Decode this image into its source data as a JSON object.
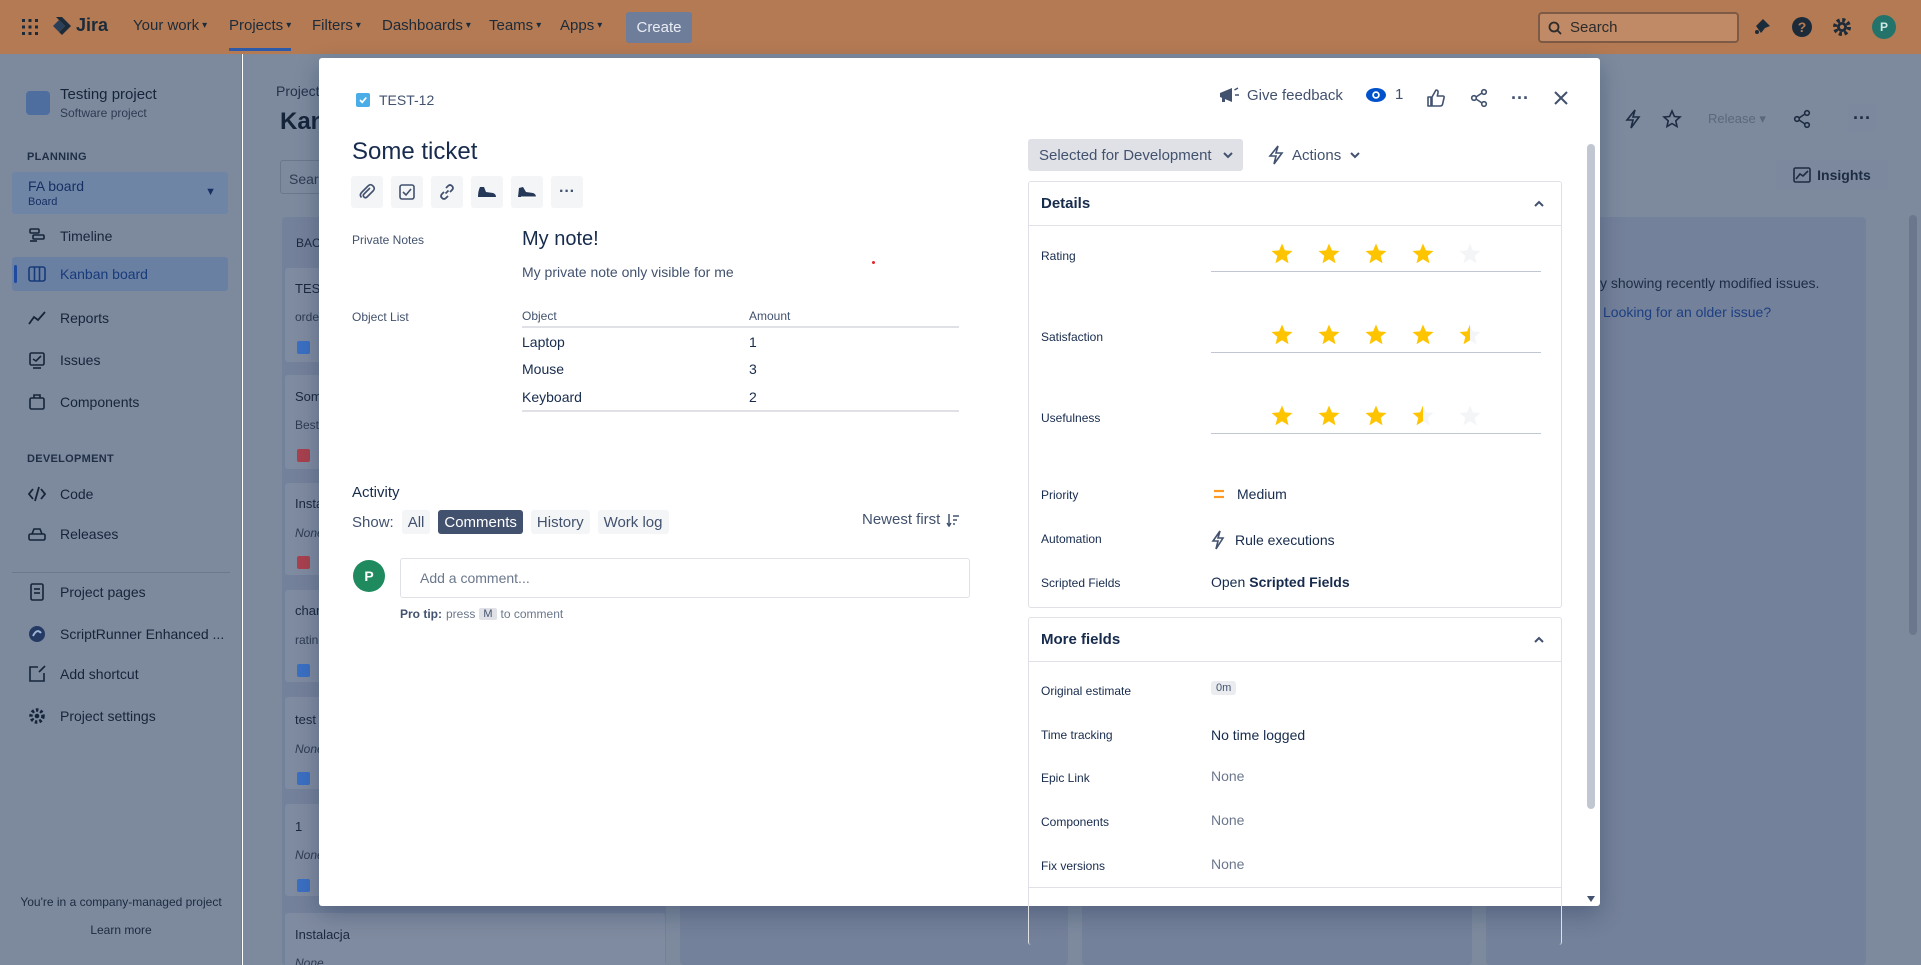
{
  "topnav": {
    "logo": "Jira",
    "items": [
      {
        "label": "Your work"
      },
      {
        "label": "Projects"
      },
      {
        "label": "Filters"
      },
      {
        "label": "Dashboards"
      },
      {
        "label": "Teams"
      },
      {
        "label": "Apps"
      }
    ],
    "create_label": "Create",
    "search_placeholder": "Search",
    "avatar_initial": "P"
  },
  "sidebar": {
    "project_name": "Testing project",
    "project_type": "Software project",
    "planning_title": "PLANNING",
    "board_name": "FA board",
    "board_sub": "Board",
    "planning_items": [
      {
        "label": "Timeline",
        "icon": "timeline-icon"
      },
      {
        "label": "Kanban board",
        "icon": "board-icon"
      },
      {
        "label": "Reports",
        "icon": "reports-icon"
      },
      {
        "label": "Issues",
        "icon": "issues-icon"
      },
      {
        "label": "Components",
        "icon": "components-icon"
      }
    ],
    "development_title": "DEVELOPMENT",
    "development_items": [
      {
        "label": "Code",
        "icon": "code-icon"
      },
      {
        "label": "Releases",
        "icon": "releases-icon"
      }
    ],
    "bottom_items": [
      {
        "label": "Project pages",
        "icon": "pages-icon"
      },
      {
        "label": "ScriptRunner Enhanced ...",
        "icon": "scriptrunner-icon"
      },
      {
        "label": "Add shortcut",
        "icon": "add-shortcut-icon"
      },
      {
        "label": "Project settings",
        "icon": "settings-icon"
      }
    ],
    "footer_text": "You're in a company-managed project",
    "footer_link": "Learn more"
  },
  "background": {
    "breadcrumb": "Project",
    "title": "Kan",
    "search_stub": "Search",
    "backlog_stub": "BAC",
    "cards": [
      {
        "title": "TEST",
        "sub": "orde"
      },
      {
        "title": "Som",
        "sub": "Best"
      },
      {
        "title": "Insta",
        "sub": "None"
      },
      {
        "title": "char",
        "sub": "ratin"
      },
      {
        "title": "test",
        "sub": "None"
      },
      {
        "title": "1",
        "sub": "None"
      },
      {
        "title": "Instalacja",
        "sub": "None"
      }
    ],
    "release_label": "Release",
    "insights_label": "Insights",
    "info_text": "y showing recently modified issues.",
    "info_link": "Looking for an older issue?"
  },
  "modal": {
    "issue_key": "TEST-12",
    "feedback_label": "Give feedback",
    "watch_count": "1",
    "title": "Some ticket",
    "private_notes_label": "Private Notes",
    "note_heading": "My note!",
    "note_text": "My private note only visible for me",
    "object_list_label": "Object List",
    "object_table": {
      "headers": [
        "Object",
        "Amount"
      ],
      "rows": [
        [
          "Laptop",
          "1"
        ],
        [
          "Mouse",
          "3"
        ],
        [
          "Keyboard",
          "2"
        ]
      ]
    },
    "activity": {
      "heading": "Activity",
      "show_label": "Show:",
      "filters": [
        "All",
        "Comments",
        "History",
        "Work log"
      ],
      "selected_filter": "Comments",
      "sort_label": "Newest first",
      "comment_avatar": "P",
      "comment_placeholder": "Add a comment...",
      "protip_prefix": "Pro tip:",
      "protip_press": "press",
      "protip_key": "M",
      "protip_suffix": "to comment"
    },
    "status": "Selected for Development",
    "actions_label": "Actions",
    "details": {
      "heading": "Details",
      "ratings": [
        {
          "label": "Rating",
          "value": 4
        },
        {
          "label": "Satisfaction",
          "value": 4.5
        },
        {
          "label": "Usefulness",
          "value": 3.5
        }
      ],
      "priority_label": "Priority",
      "priority_value": "Medium",
      "automation_label": "Automation",
      "automation_value": "Rule executions",
      "scripted_label": "Scripted Fields",
      "scripted_value_prefix": "Open",
      "scripted_value_bold": "Scripted Fields"
    },
    "more_fields": {
      "heading": "More fields",
      "fields": [
        {
          "label": "Original estimate",
          "value": "0m"
        },
        {
          "label": "Time tracking",
          "value": "No time logged"
        },
        {
          "label": "Epic Link",
          "value": "None"
        },
        {
          "label": "Components",
          "value": "None"
        },
        {
          "label": "Fix versions",
          "value": "None"
        }
      ]
    }
  },
  "colors": {
    "star_fill": "#ffc400",
    "star_empty": "#f4f5f7",
    "priority_medium": "#ff991f"
  }
}
